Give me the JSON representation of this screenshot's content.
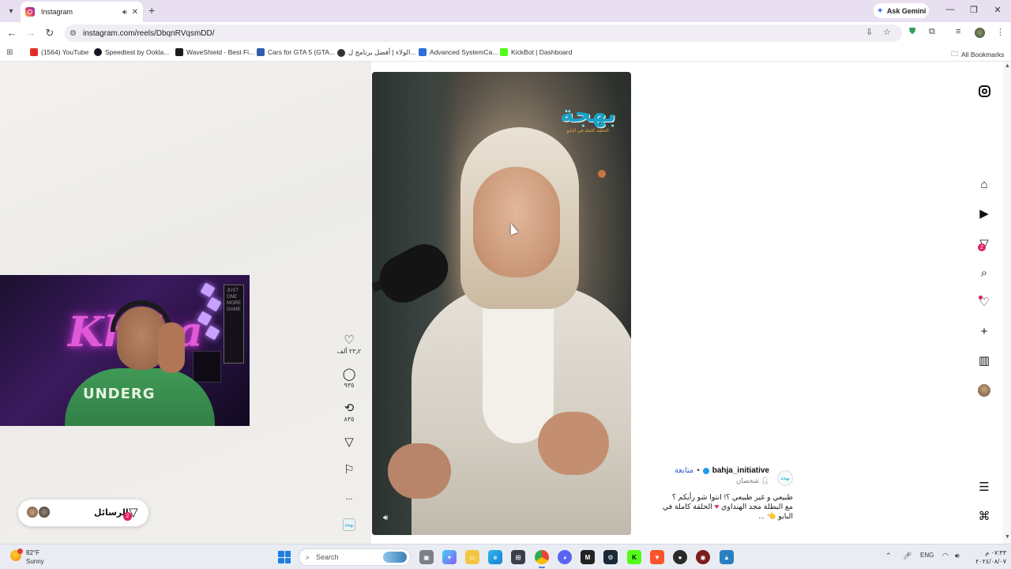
{
  "browser": {
    "tab": {
      "title": "Instagram",
      "audio_icon": "speaker-icon",
      "close": "✕"
    },
    "new_tab": "+",
    "gemini_label": "Ask Gemini",
    "window_controls": {
      "minimize": "—",
      "restore": "❐",
      "close": "✕"
    },
    "url": "instagram.com/reels/DbqnRVqsmDD/",
    "bookmarks": [
      {
        "label": "(1564) YouTube",
        "color": "#e52d27"
      },
      {
        "label": "Speedtest by Ookla...",
        "color": "#141526"
      },
      {
        "label": "WaveShield - Best Fi...",
        "color": "#1c1c1c"
      },
      {
        "label": "Cars for GTA 5 (GTA...",
        "color": "#2f5fa8"
      },
      {
        "label": "الولاء | أفضل برنامج ل...",
        "color": "#333333"
      },
      {
        "label": "Advanced SystemCa...",
        "color": "#2f6fd6"
      },
      {
        "label": "KickBot | Dashboard",
        "color": "#53fc18"
      }
    ],
    "all_bookmarks": "All Bookmarks"
  },
  "reel": {
    "logo_text": "بهجة",
    "logo_sub": "الحلقة كاملة في البايو"
  },
  "actions": {
    "likes": "٢٣٫٢ ألف",
    "comments": "٩٣٥",
    "reposts": "٨٣٥",
    "more": "..."
  },
  "caption": {
    "username": "bahja_initiative",
    "follow": "متابعة",
    "separator": "•",
    "subtitle": "شخصان",
    "line1": "طبيعي و غير طبيعي ؟! انتوا شو رأيكم ؟",
    "line2": "مع البطلة مجد الهنداوي",
    "line2b": "الحلقة كاملة في",
    "line3": "البايو",
    "line3_emoji": "👈",
    "ellipsis": "..."
  },
  "sidenav": {
    "messages_badge": "2"
  },
  "messages_pill": {
    "label": "الرسائل",
    "badge": "2"
  },
  "webcam": {
    "neon_text": "Kh    ka",
    "shirt_text": "UNDERG",
    "poster_text": "JUST ONE MORE GAME"
  },
  "taskbar": {
    "weather_temp": "82°F",
    "weather_cond": "Sunny",
    "search_placeholder": "Search",
    "language": "ENG",
    "time": "٠٧:٣٣ م",
    "date": "٢٠٢٤/٠٨/٠٧"
  }
}
